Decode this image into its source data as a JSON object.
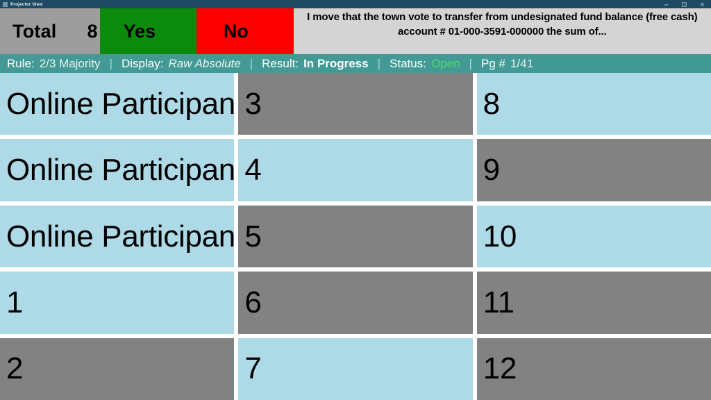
{
  "window": {
    "title": "Projector View",
    "controls": [
      {
        "name": "minimize",
        "glyph": "—"
      },
      {
        "name": "maximize",
        "glyph": "☐"
      },
      {
        "name": "close",
        "glyph": "✕"
      }
    ]
  },
  "tally": {
    "total_label": "Total",
    "total_value": "8",
    "yes_label": "Yes",
    "yes_value": "",
    "no_label": "No",
    "no_value": "",
    "colors": {
      "total_bg": "#9d9d9d",
      "yes_bg": "#0b8a0b",
      "no_bg": "#fe0000",
      "motion_bg": "#d4d4d4"
    }
  },
  "motion": {
    "text": "I move that the town vote to transfer from undesignated fund balance (free cash) account # 01-000-3591-000000 the sum of..."
  },
  "status": {
    "rule_label": "Rule:",
    "rule_value": "2/3 Majority",
    "display_label": "Display:",
    "display_value": "Raw Absolute",
    "result_label": "Result:",
    "result_value": "In Progress",
    "status_label": "Status:",
    "status_value": "Open",
    "page_label": "Pg #",
    "page_value": "1/41",
    "divider": "|",
    "colors": {
      "bar_bg": "#439a95",
      "open_fg": "#4cd964"
    }
  },
  "grid": {
    "colors": {
      "blue": "#aedae7",
      "gray": "#828282",
      "gutter": "#ffffff"
    },
    "columns": [
      {
        "cells": [
          {
            "label": "Online Participant",
            "state": "blue"
          },
          {
            "label": "Online Participant",
            "state": "blue"
          },
          {
            "label": "Online Participant",
            "state": "blue"
          },
          {
            "label": "1",
            "state": "blue"
          },
          {
            "label": "2",
            "state": "gray"
          }
        ]
      },
      {
        "cells": [
          {
            "label": "3",
            "state": "gray"
          },
          {
            "label": "4",
            "state": "blue"
          },
          {
            "label": "5",
            "state": "gray"
          },
          {
            "label": "6",
            "state": "gray"
          },
          {
            "label": "7",
            "state": "blue"
          }
        ]
      },
      {
        "cells": [
          {
            "label": "8",
            "state": "blue"
          },
          {
            "label": "9",
            "state": "gray"
          },
          {
            "label": "10",
            "state": "blue"
          },
          {
            "label": "11",
            "state": "gray"
          },
          {
            "label": "12",
            "state": "gray"
          }
        ]
      }
    ]
  }
}
